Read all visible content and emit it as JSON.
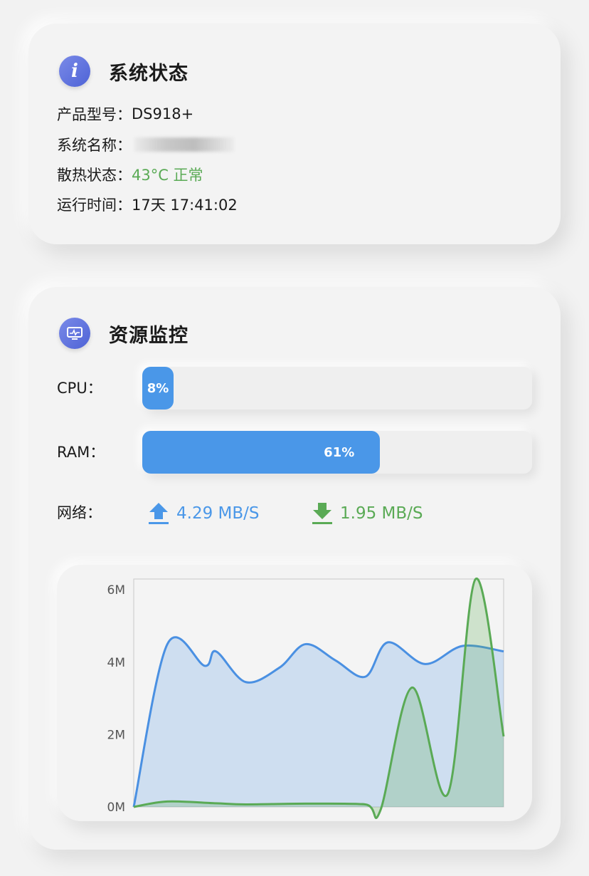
{
  "status_card": {
    "title": "系统状态",
    "icon": "info-icon",
    "rows": [
      {
        "key": "产品型号：",
        "value": "DS918+"
      },
      {
        "key": "系统名称：",
        "value": ""
      },
      {
        "key": "散热状态：",
        "value": "43°C 正常"
      },
      {
        "key": "运行时间：",
        "value": "17天 17:41:02"
      }
    ],
    "ok_color": "#5aaa55"
  },
  "resource_card": {
    "title": "资源监控",
    "icon": "monitor-icon",
    "cpu": {
      "label": "CPU：",
      "percent": 8,
      "text": "8%"
    },
    "ram": {
      "label": "RAM：",
      "percent": 61,
      "text": "61%"
    },
    "network": {
      "label": "网络：",
      "upload": {
        "icon": "upload-arrow-icon",
        "value": "4.29 MB/S",
        "color": "#4a97e8"
      },
      "download": {
        "icon": "download-arrow-icon",
        "value": "1.95 MB/S",
        "color": "#5aaa55"
      }
    }
  },
  "chart_data": {
    "type": "area",
    "title": "",
    "xlabel": "",
    "ylabel": "",
    "ylim": [
      0,
      6.3
    ],
    "yticks": [
      {
        "value": 0,
        "label": "0M"
      },
      {
        "value": 2,
        "label": "2M"
      },
      {
        "value": 4,
        "label": "4M"
      },
      {
        "value": 6,
        "label": "6M"
      }
    ],
    "grid": false,
    "series": [
      {
        "color": "#4a90e2",
        "fill": "rgba(74,144,226,0.22)",
        "points": [
          [
            0,
            0
          ],
          [
            0.9,
            4.5
          ],
          [
            1.9,
            3.9
          ],
          [
            2.2,
            4.3
          ],
          [
            3.0,
            3.45
          ],
          [
            3.9,
            3.85
          ],
          [
            4.6,
            4.5
          ],
          [
            5.4,
            4.05
          ],
          [
            6.2,
            3.6
          ],
          [
            6.8,
            4.55
          ],
          [
            7.8,
            3.95
          ],
          [
            8.8,
            4.45
          ],
          [
            9.9,
            4.3
          ]
        ]
      },
      {
        "color": "#5aaa55",
        "fill": "rgba(90,170,85,0.25)",
        "points": [
          [
            0,
            0
          ],
          [
            0.9,
            0.15
          ],
          [
            2.2,
            0.1
          ],
          [
            3.0,
            0.07
          ],
          [
            4.6,
            0.09
          ],
          [
            6.2,
            0.07
          ],
          [
            6.6,
            -0.1
          ],
          [
            7.45,
            3.3
          ],
          [
            8.4,
            0.35
          ],
          [
            9.15,
            6.3
          ],
          [
            9.9,
            1.95
          ]
        ]
      }
    ],
    "xlim": [
      0,
      9.9
    ]
  }
}
